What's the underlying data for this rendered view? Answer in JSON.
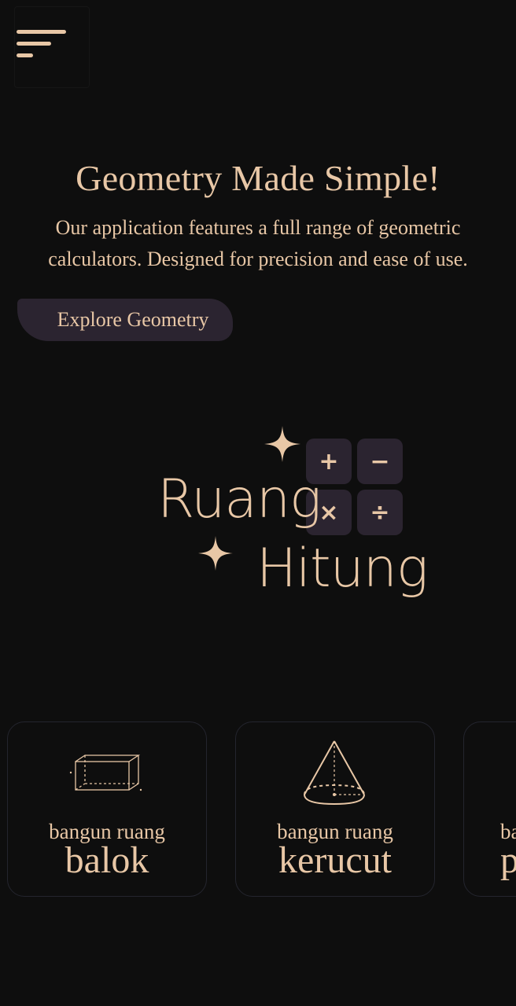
{
  "colors": {
    "background": "#0e0e0e",
    "accent": "#e8c7a6",
    "surface": "#2b2430",
    "card_border": "#24252e"
  },
  "nav": {
    "menu_icon": "hamburger-menu-icon"
  },
  "hero": {
    "title": "Geometry Made Simple!",
    "description": "Our application features a full range of geometric calculators. Designed for precision and ease of use.",
    "cta_label": "Explore Geometry"
  },
  "logo": {
    "word1": "Ruang",
    "word2": "Hitung",
    "keys": [
      "+",
      "−",
      "×",
      "÷"
    ],
    "sparkle_icon": "sparkle-icon"
  },
  "cards": [
    {
      "subtitle": "bangun ruang",
      "title": "balok",
      "icon": "cuboid-icon"
    },
    {
      "subtitle": "bangun ruang",
      "title": "kerucut",
      "icon": "cone-icon"
    },
    {
      "subtitle": "ba",
      "title": "p",
      "icon": ""
    }
  ]
}
